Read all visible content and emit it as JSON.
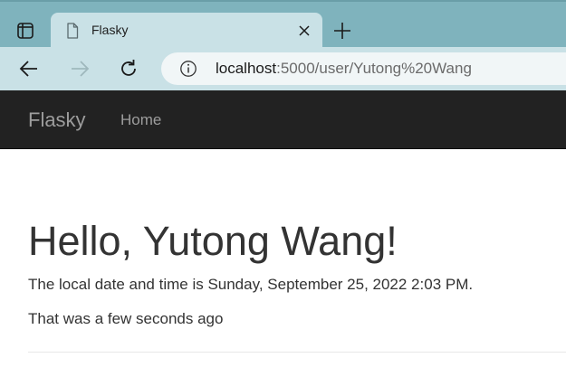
{
  "browser": {
    "tab": {
      "title": "Flasky"
    },
    "address_bar": {
      "host": "localhost",
      "rest": ":5000/user/Yutong%20Wang"
    },
    "icons": {
      "tab_actions": "tab-actions-icon",
      "favicon": "document-icon",
      "close": "close-icon",
      "new_tab": "plus-icon",
      "back": "back-arrow-icon",
      "forward": "forward-arrow-icon",
      "reload": "reload-icon",
      "site_info": "info-icon"
    },
    "colors": {
      "tabstrip": "#7fb3bd",
      "toolbar": "#c9e1e6",
      "forward_disabled": "#9fb8bd"
    }
  },
  "navbar": {
    "brand": "Flasky",
    "links": [
      {
        "label": "Home"
      }
    ],
    "colors": {
      "background": "#222222",
      "text": "#9d9d9d"
    }
  },
  "page": {
    "heading": "Hello, Yutong Wang!",
    "local_time": "The local date and time is Sunday, September 25, 2022 2:03 PM.",
    "relative_time": "That was a few seconds ago"
  }
}
